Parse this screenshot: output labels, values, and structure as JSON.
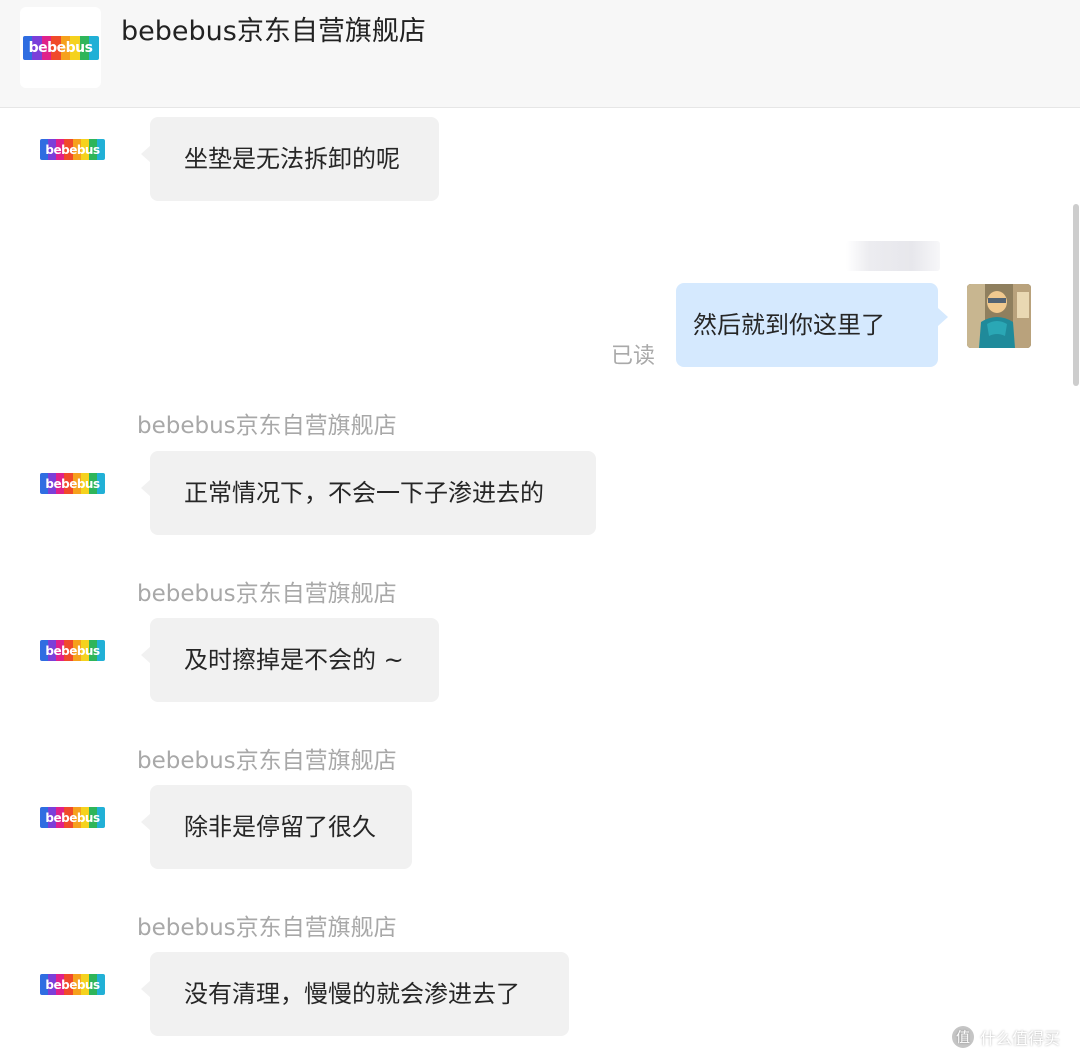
{
  "header": {
    "title": "bebebus京东自营旗舰店",
    "logo_text": "bebebus"
  },
  "logo": {
    "text": "bebebus",
    "band_colors": [
      "#2f6de1",
      "#7b3fd9",
      "#e0218a",
      "#f04a2a",
      "#f6a11c",
      "#f5d21e",
      "#2fb55a",
      "#21b0d6"
    ]
  },
  "messages": [
    {
      "from": "shop",
      "sender": "",
      "text": "坐垫是无法拆卸的呢"
    },
    {
      "from": "me",
      "text": "然后就到你这里了",
      "status": "已读"
    },
    {
      "from": "shop",
      "sender": "bebebus京东自营旗舰店",
      "text": "正常情况下，不会一下子渗进去的"
    },
    {
      "from": "shop",
      "sender": "bebebus京东自营旗舰店",
      "text": "及时擦掉是不会的 ~"
    },
    {
      "from": "shop",
      "sender": "bebebus京东自营旗舰店",
      "text": "除非是停留了很久"
    },
    {
      "from": "shop",
      "sender": "bebebus京东自营旗舰店",
      "text": "没有清理，慢慢的就会渗进去了"
    }
  ],
  "watermark": {
    "icon": "值",
    "text": "什么值得买"
  },
  "colors": {
    "header_bg": "#f7f7f7",
    "bubble_shop": "#f1f1f1",
    "bubble_me": "#d5e9fe",
    "sender_name": "#a8a8a8"
  }
}
